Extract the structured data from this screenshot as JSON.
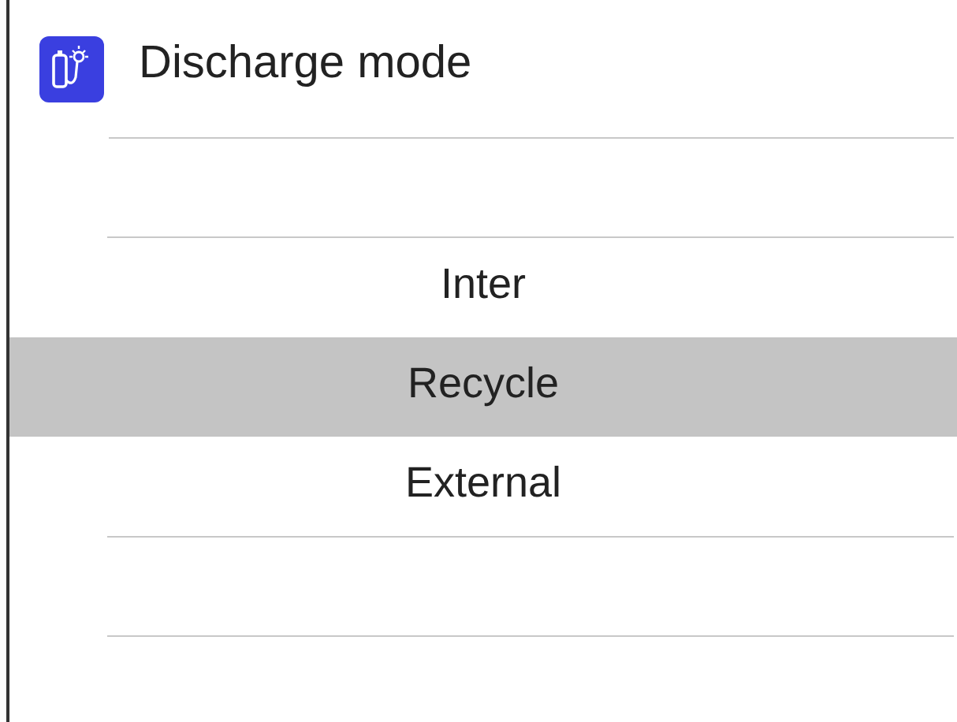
{
  "title": "Discharge mode",
  "options": [
    {
      "label": "Inter",
      "selected": false
    },
    {
      "label": "Recycle",
      "selected": true
    },
    {
      "label": "External",
      "selected": false
    }
  ]
}
